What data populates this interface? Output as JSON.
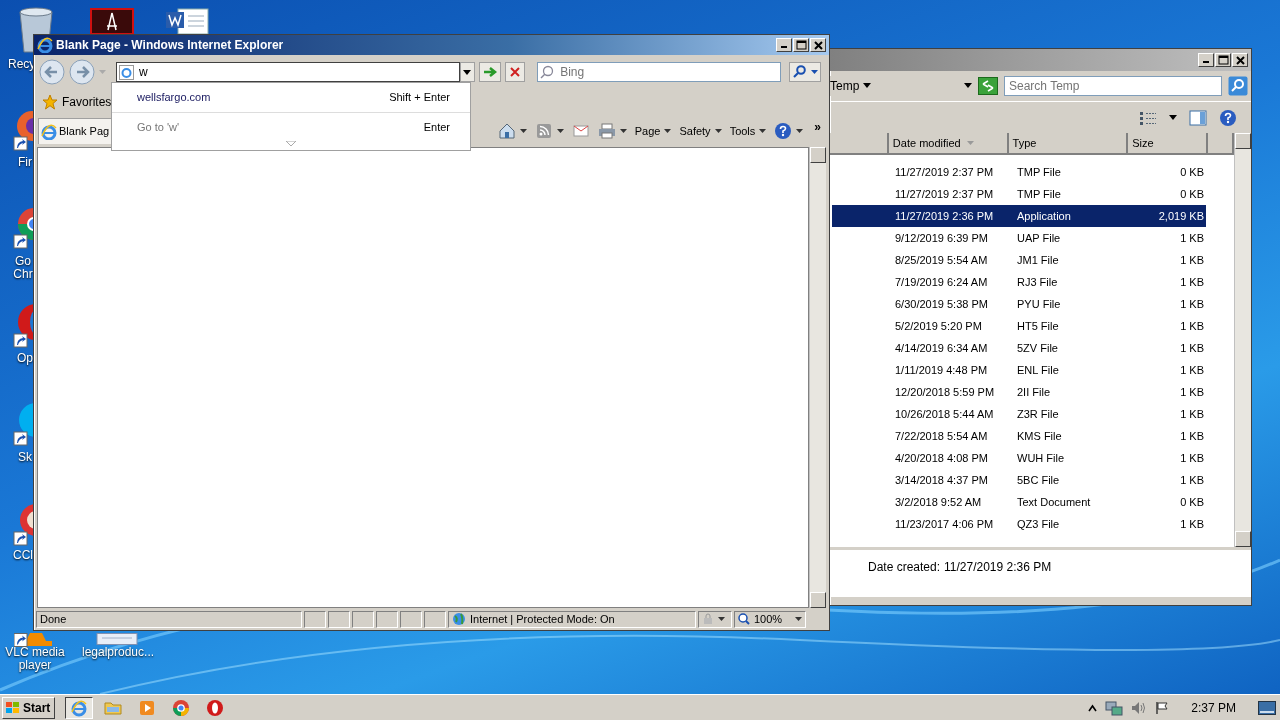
{
  "desktop_icons": [
    {
      "kind": "recycle",
      "label": "Recy"
    },
    {
      "kind": "pdf"
    },
    {
      "kind": "word"
    },
    {
      "kind": "firefox",
      "label": "Fir"
    },
    {
      "kind": "chrome",
      "label": "Go Chr"
    },
    {
      "kind": "opera",
      "label": "Op"
    },
    {
      "kind": "skype",
      "label": "Sk"
    },
    {
      "kind": "ccleaner",
      "label": "CCl"
    },
    {
      "kind": "vlc",
      "label": "VLC media player"
    },
    {
      "kind": "document",
      "label": "legalproduc..."
    }
  ],
  "explorer": {
    "breadcrumb": "Temp",
    "search": {
      "placeholder": "Search Temp"
    },
    "columns": [
      {
        "label": "Date modified",
        "sorted": true
      },
      {
        "label": "Type",
        "sorted": false
      },
      {
        "label": "Size",
        "sorted": false
      }
    ],
    "rows": [
      {
        "date": "11/27/2019 2:37 PM",
        "type": "TMP File",
        "size": "0 KB",
        "selected": false
      },
      {
        "date": "11/27/2019 2:37 PM",
        "type": "TMP File",
        "size": "0 KB",
        "selected": false
      },
      {
        "date": "11/27/2019 2:36 PM",
        "type": "Application",
        "size": "2,019 KB",
        "selected": true
      },
      {
        "date": "9/12/2019 6:39 PM",
        "type": "UAP File",
        "size": "1 KB",
        "selected": false
      },
      {
        "date": "8/25/2019 5:54 AM",
        "type": "JM1 File",
        "size": "1 KB",
        "selected": false
      },
      {
        "date": "7/19/2019 6:24 AM",
        "type": "RJ3 File",
        "size": "1 KB",
        "selected": false
      },
      {
        "date": "6/30/2019 5:38 PM",
        "type": "PYU File",
        "size": "1 KB",
        "selected": false
      },
      {
        "date": "5/2/2019 5:20 PM",
        "type": "HT5 File",
        "size": "1 KB",
        "selected": false
      },
      {
        "date": "4/14/2019 6:34 AM",
        "type": "5ZV File",
        "size": "1 KB",
        "selected": false
      },
      {
        "date": "1/11/2019 4:48 PM",
        "type": "ENL File",
        "size": "1 KB",
        "selected": false
      },
      {
        "date": "12/20/2018 5:59 PM",
        "type": "2II File",
        "size": "1 KB",
        "selected": false
      },
      {
        "date": "10/26/2018 5:44 AM",
        "type": "Z3R File",
        "size": "1 KB",
        "selected": false
      },
      {
        "date": "7/22/2018 5:54 AM",
        "type": "KMS File",
        "size": "1 KB",
        "selected": false
      },
      {
        "date": "4/20/2018 4:08 PM",
        "type": "WUH File",
        "size": "1 KB",
        "selected": false
      },
      {
        "date": "3/14/2018 4:37 PM",
        "type": "5BC File",
        "size": "1 KB",
        "selected": false
      },
      {
        "date": "3/2/2018 9:52 AM",
        "type": "Text Document",
        "size": "0 KB",
        "selected": false
      },
      {
        "date": "11/23/2017 4:06 PM",
        "type": "QZ3 File",
        "size": "1 KB",
        "selected": false
      }
    ],
    "details": {
      "label": "Date created:",
      "value": "11/27/2019 2:36 PM"
    }
  },
  "ie": {
    "title": "Blank Page - Windows Internet Explorer",
    "address": {
      "value": "w"
    },
    "search": {
      "placeholder": "Bing"
    },
    "autocomplete": [
      {
        "kind": "suggestion",
        "text": "wellsfargo.com",
        "shortcut": "Shift + Enter"
      },
      {
        "kind": "goto",
        "text": "Go to 'w'",
        "shortcut": "Enter"
      }
    ],
    "favorites": "Favorites",
    "tabs": [
      {
        "label": "Blank Pag",
        "selected": true
      }
    ],
    "commands": [
      {
        "kind": "home"
      },
      {
        "kind": "feeds"
      },
      {
        "kind": "mail"
      },
      {
        "kind": "print"
      },
      {
        "kind": "menu",
        "label": "Page"
      },
      {
        "kind": "menu",
        "label": "Safety"
      },
      {
        "kind": "menu",
        "label": "Tools"
      },
      {
        "kind": "help"
      }
    ],
    "overflow": "»",
    "status": {
      "text": "Done",
      "zone": "Internet | Protected Mode: On",
      "zoom": "100%"
    }
  },
  "taskbar": {
    "start": "Start",
    "apps": [
      {
        "kind": "ie",
        "selected": true
      },
      {
        "kind": "explorer",
        "selected": false
      },
      {
        "kind": "media",
        "selected": false
      },
      {
        "kind": "chrome",
        "selected": false
      },
      {
        "kind": "opera",
        "selected": false
      }
    ],
    "clock": "2:37 PM"
  }
}
